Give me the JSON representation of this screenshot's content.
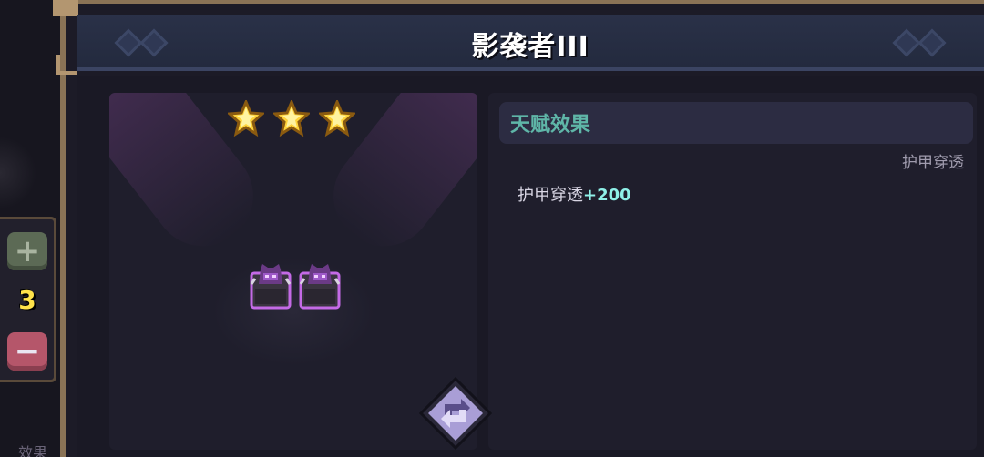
{
  "left_panel": {
    "plus_label": "+",
    "count": "3",
    "minus_label": "−",
    "footer_label": "效果"
  },
  "header": {
    "title": "影袭者III"
  },
  "showcase": {
    "stars": 3,
    "unit_count": 2,
    "refresh_icon": "refresh-icon"
  },
  "talent": {
    "title": "天赋效果",
    "tag": "护甲穿透",
    "effect_name": "护甲穿透",
    "effect_value": "+200"
  },
  "colors": {
    "frame": "#8a7356",
    "title_bar": "#2a3148",
    "star": "#ffd43a",
    "unit_glow": "#c46ae6",
    "talent_title": "#5fb6a8",
    "effect_value": "#8ff0e8",
    "count": "#ffe24a"
  }
}
